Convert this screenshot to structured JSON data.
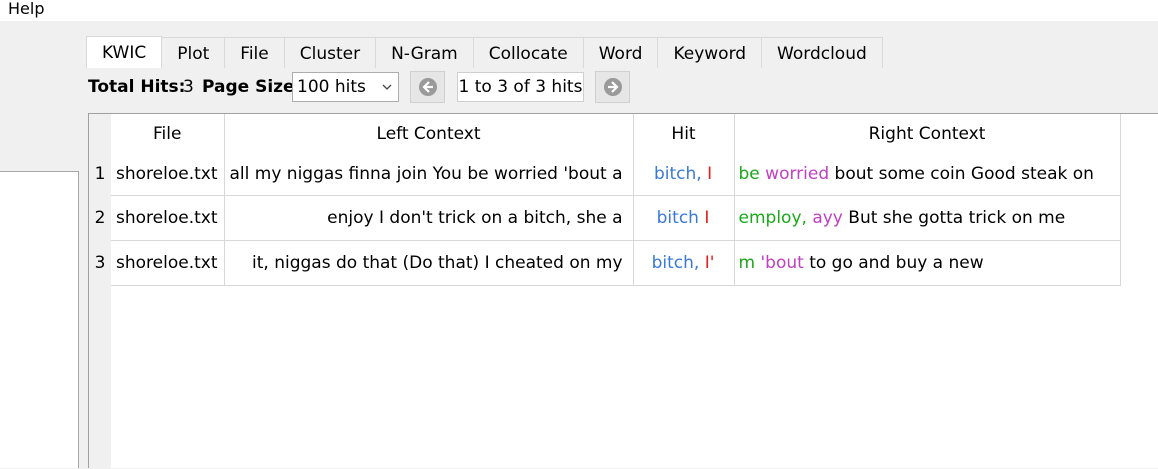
{
  "menu": {
    "help": "Help"
  },
  "tabs": [
    "KWIC",
    "Plot",
    "File",
    "Cluster",
    "N-Gram",
    "Collocate",
    "Word",
    "Keyword",
    "Wordcloud"
  ],
  "toolbar": {
    "total_hits_label": "Total Hits:",
    "total_hits_value": "3",
    "page_size_label": "Page Size",
    "page_size_value": "100 hits",
    "pager_text": "1 to 3 of 3 hits"
  },
  "colors": {
    "hit_word": "#3b78d8",
    "hit_second": "#e0201e",
    "right_first": "#1aa81a",
    "right_second": "#c040c0"
  },
  "table": {
    "headers": {
      "file": "File",
      "left": "Left Context",
      "hit": "Hit",
      "right": "Right Context"
    },
    "rows": [
      {
        "num": "1",
        "file": "shoreloe.txt",
        "left": "all my niggas finna join You be worried 'bout a",
        "hit_a": "bitch,",
        "hit_b": "I",
        "right_a": "be",
        "right_b": "worried",
        "right_rest": "bout some coin Good steak on"
      },
      {
        "num": "2",
        "file": "shoreloe.txt",
        "left": "enjoy I don't trick on a bitch, she a",
        "hit_a": "bitch",
        "hit_b": "I",
        "right_a": "employ,",
        "right_b": "ayy",
        "right_rest": "But she gotta trick on me"
      },
      {
        "num": "3",
        "file": "shoreloe.txt",
        "left": "it, niggas do that (Do that) I cheated on my",
        "hit_a": "bitch,",
        "hit_b": "I'",
        "right_a": "m",
        "right_b": "'bout",
        "right_rest": "to go and buy a new"
      }
    ]
  }
}
